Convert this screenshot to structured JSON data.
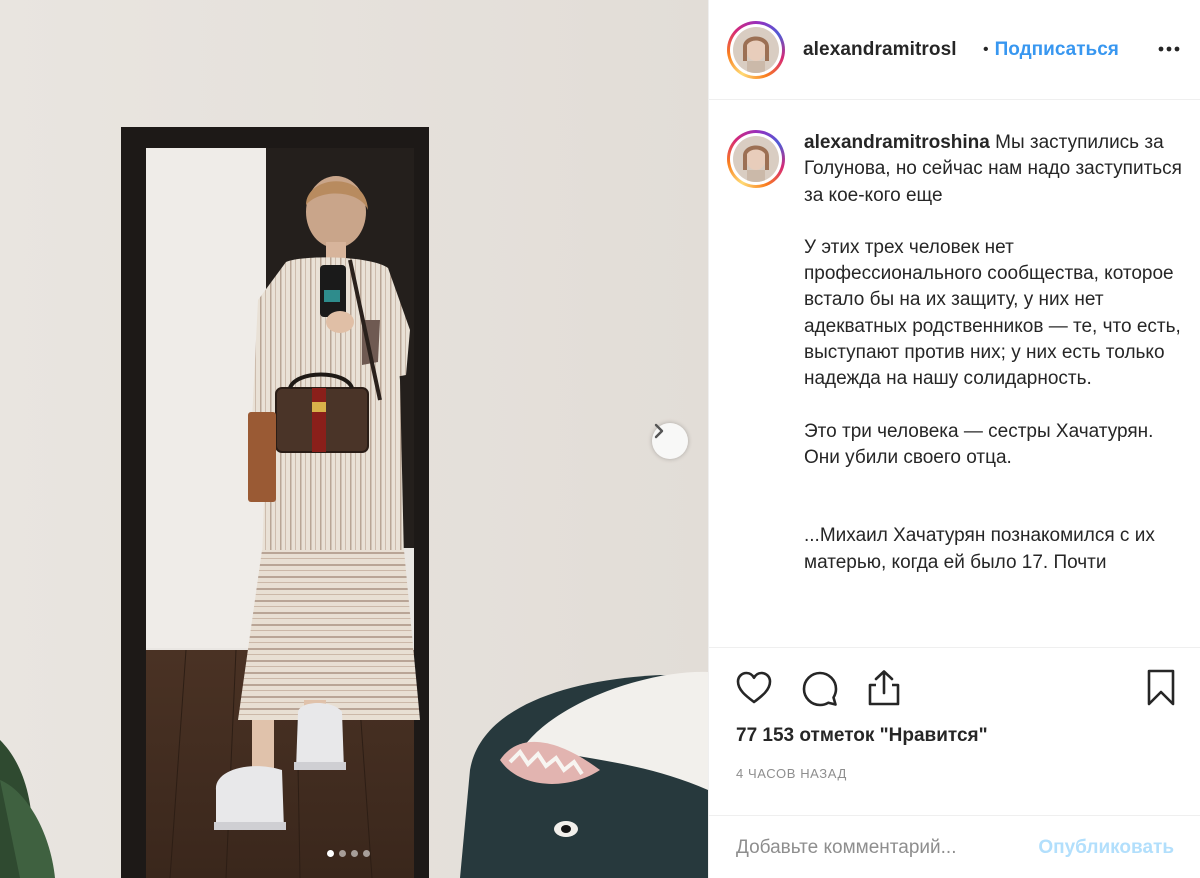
{
  "post": {
    "username": "alexandramitroshina",
    "header_username": "alexandramitrosl",
    "separator": "•",
    "follow_label": "Подписаться",
    "caption_first": "Мы заступились за Голунова, но сейчас нам надо заступиться за кое-кого еще",
    "caption_paragraphs": [
      "У этих трех человек нет профессионального сообщества, которое встало бы на их защиту, у них нет адекватных родственников — те, что есть, выступают против них; у них есть только надежда на нашу солидарность.",
      "Это три человека — сестры Хачатурян.",
      "Они убили своего отца.",
      "...Михаил Хачатурян познакомился с их матерью, когда ей было 17. Почти"
    ],
    "likes_text": "77 153 отметок \"Нравится\"",
    "time_ago": "4 ЧАСОВ НАЗАД",
    "comment_placeholder": "Добавьте комментарий...",
    "publish_label": "Опубликовать"
  },
  "carousel": {
    "total": 4,
    "current": 1
  },
  "icons": {
    "like": "heart-icon",
    "comment": "comment-bubble-icon",
    "share": "share-icon",
    "save": "bookmark-icon",
    "more": "more-horizontal-icon",
    "next": "chevron-right-icon"
  },
  "colors": {
    "link": "#3897f0",
    "publish_disabled": "#b2dffc",
    "muted": "#8e8e8e",
    "text": "#262626"
  }
}
